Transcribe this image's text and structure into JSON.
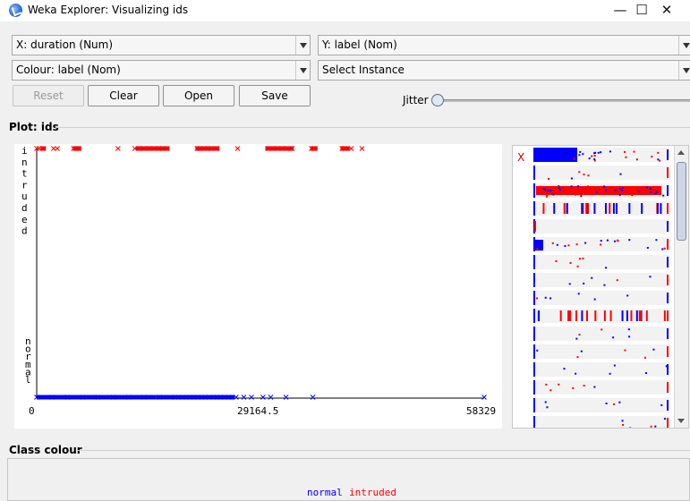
{
  "window": {
    "title": "Weka Explorer: Visualizing ids",
    "minimize": "—",
    "maximize": "☐",
    "close": "✕"
  },
  "controls": {
    "x_axis": "X: duration (Num)",
    "y_axis": "Y: label (Nom)",
    "colour": "Colour: label (Nom)",
    "select_instance": "Select Instance",
    "reset": "Reset",
    "clear": "Clear",
    "open": "Open",
    "save": "Save",
    "jitter": "Jitter",
    "jitter_value": 0
  },
  "plot": {
    "title": "Plot: ids",
    "y_labels": [
      "intruded",
      "normal"
    ],
    "x_min": "0",
    "x_mid": "29164.5",
    "x_max": "58329"
  },
  "attr_panel": {
    "class_marker": "X"
  },
  "class_colour": {
    "title": "Class colour",
    "classes": [
      {
        "name": "normal",
        "color": "#0000ff"
      },
      {
        "name": "intruded",
        "color": "#ff0000"
      }
    ]
  },
  "colors": {
    "normal": "#0000ff",
    "intruded": "#ff0000"
  },
  "chart_data": {
    "type": "scatter",
    "title": "Plot: ids",
    "xlabel": "duration",
    "ylabel": "label",
    "xlim": [
      0,
      58329
    ],
    "y_categories": [
      "normal",
      "intruded"
    ],
    "x_ticks": [
      "0",
      "29164.5",
      "58329"
    ],
    "series": [
      {
        "name": "intruded",
        "color": "#ff0000",
        "y": "intruded",
        "x": [
          0,
          300,
          800,
          2200,
          2700,
          4800,
          5200,
          5500,
          10600,
          12800,
          13400,
          14000,
          14700,
          15300,
          15900,
          16400,
          17000,
          20900,
          21300,
          21800,
          22300,
          22800,
          23500,
          26200,
          30200,
          30800,
          31400,
          32000,
          32600,
          33300,
          35800,
          36200,
          39800,
          40200,
          41000,
          42400
        ],
        "clusters": [
          [
            500,
            1200
          ],
          [
            4700,
            5800
          ],
          [
            12900,
            17300
          ],
          [
            20700,
            23800
          ],
          [
            29800,
            33500
          ],
          [
            35700,
            36600
          ],
          [
            39600,
            40800
          ]
        ]
      },
      {
        "name": "normal",
        "color": "#0000ff",
        "y": "normal",
        "x": [
          0,
          2000,
          4000,
          6000,
          8000,
          10000,
          12000,
          14000,
          16000,
          18000,
          19000,
          20000,
          21000,
          22000,
          23000,
          24000,
          25000,
          26000,
          27000,
          28000,
          29500,
          30500,
          32500,
          36000,
          58329
        ],
        "clusters": [
          [
            0,
            15600
          ],
          [
            15600,
            25800
          ]
        ]
      }
    ]
  }
}
